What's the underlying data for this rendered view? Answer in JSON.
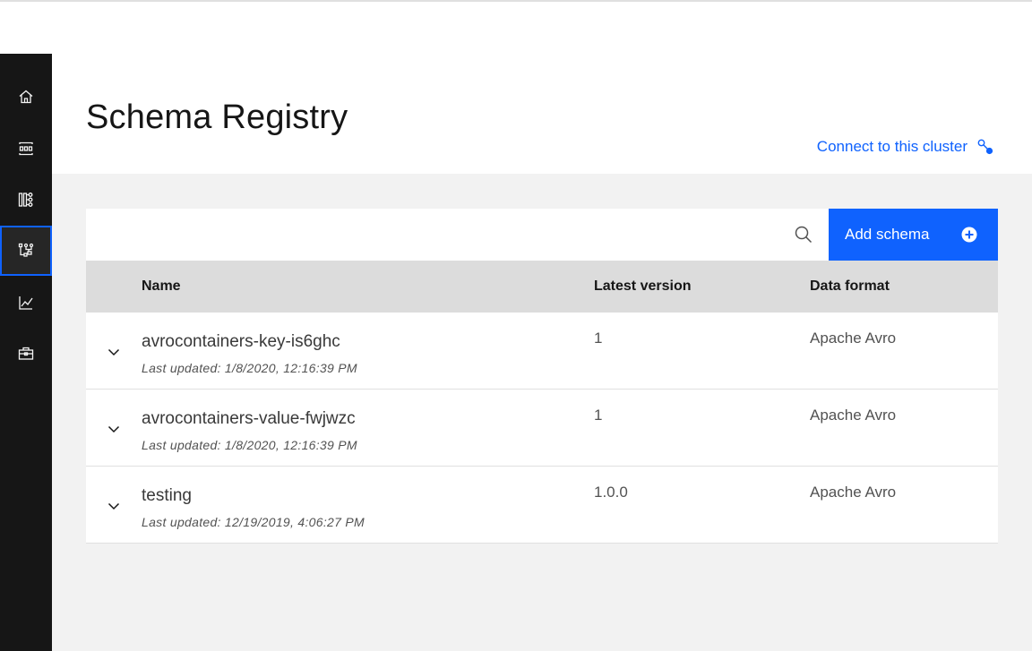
{
  "page": {
    "title": "Schema Registry",
    "connect_label": "Connect to this cluster"
  },
  "sidebar": {
    "items": [
      {
        "icon": "home-icon"
      },
      {
        "icon": "topics-icon"
      },
      {
        "icon": "consumer-groups-icon"
      },
      {
        "icon": "schema-registry-icon",
        "active": true
      },
      {
        "icon": "monitoring-icon"
      },
      {
        "icon": "toolbox-icon"
      }
    ]
  },
  "toolbar": {
    "add_label": "Add schema"
  },
  "table": {
    "headers": {
      "name": "Name",
      "version": "Latest version",
      "format": "Data format"
    },
    "rows": [
      {
        "name": "avrocontainers-key-is6ghc",
        "updated": "Last updated: 1/8/2020, 12:16:39 PM",
        "version": "1",
        "format": "Apache Avro"
      },
      {
        "name": "avrocontainers-value-fwjwzc",
        "updated": "Last updated: 1/8/2020, 12:16:39 PM",
        "version": "1",
        "format": "Apache Avro"
      },
      {
        "name": "testing",
        "updated": "Last updated: 12/19/2019, 4:06:27 PM",
        "version": "1.0.0",
        "format": "Apache Avro"
      }
    ]
  },
  "colors": {
    "accent": "#0f62fe",
    "sidebar": "#161616"
  }
}
